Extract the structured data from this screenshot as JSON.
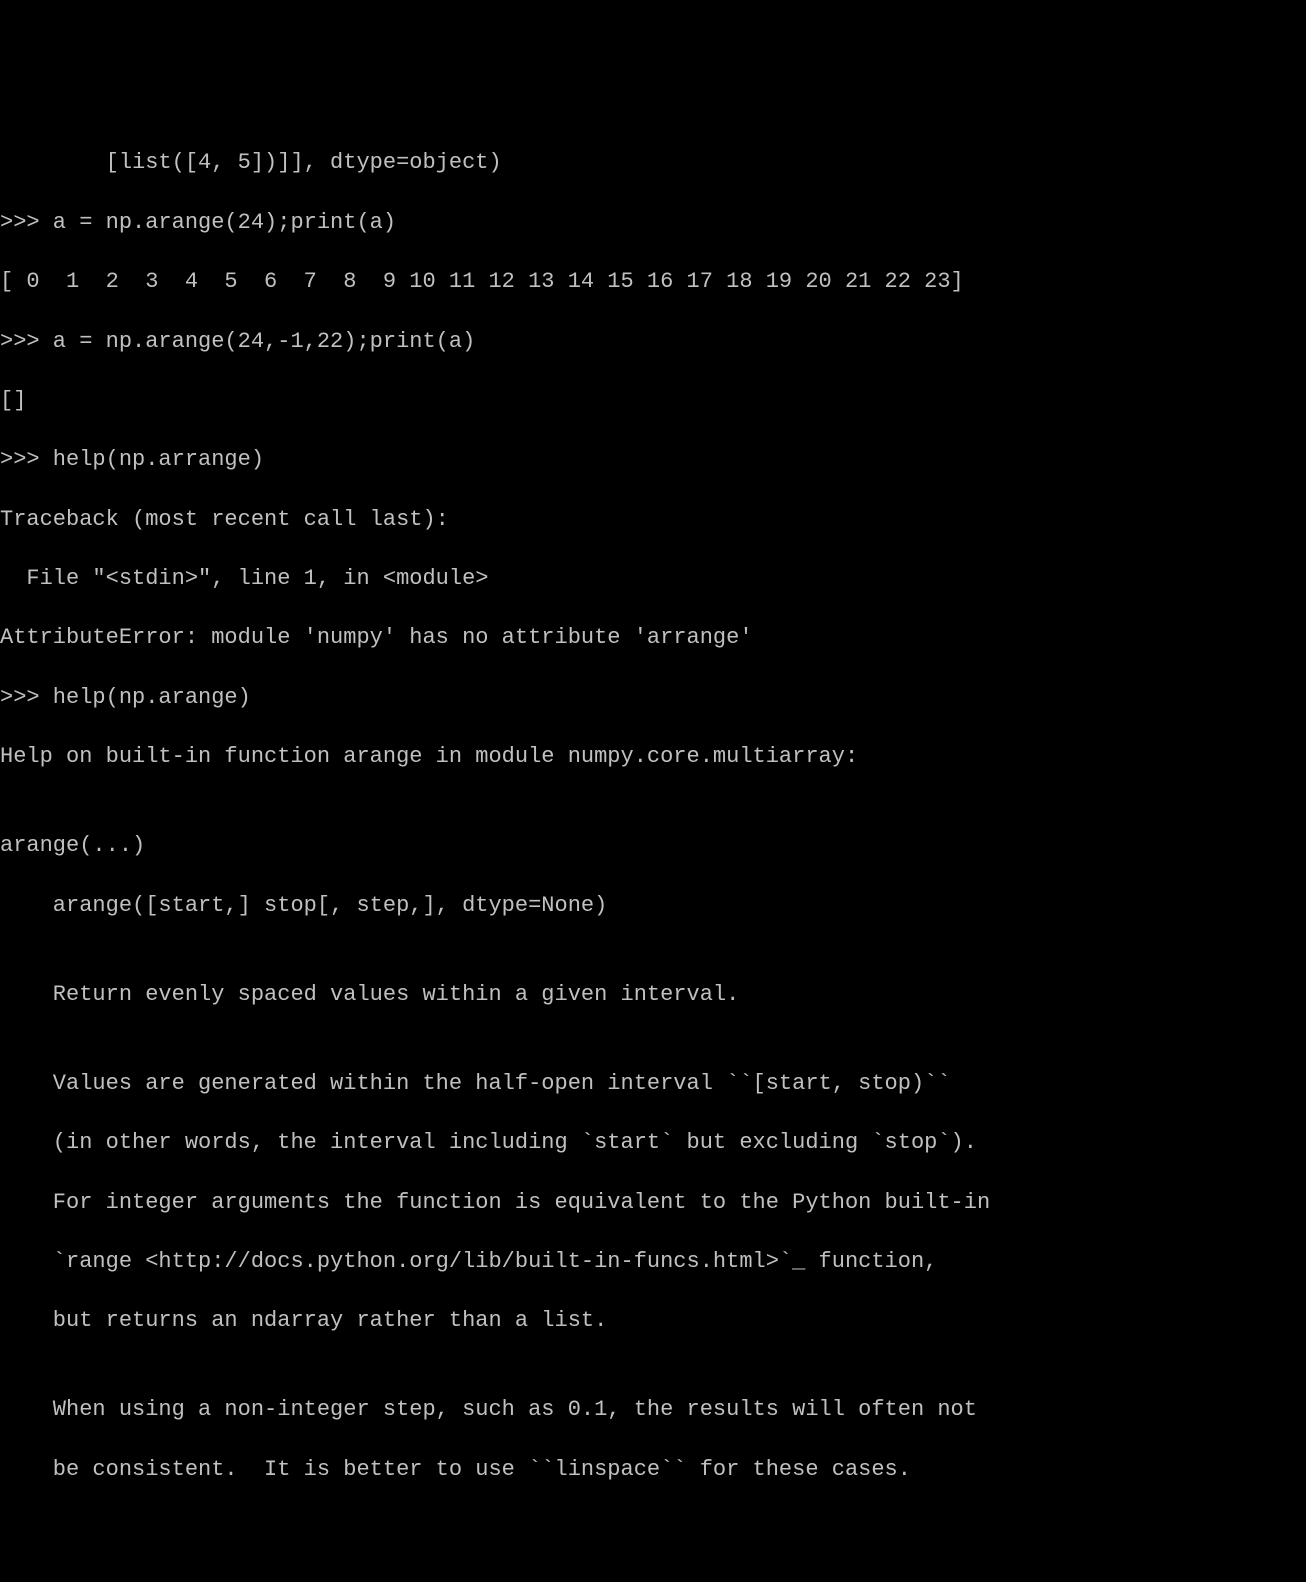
{
  "terminal": {
    "lines": [
      "        [list([4, 5])]], dtype=object)",
      ">>> a = np.arange(24);print(a)",
      "[ 0  1  2  3  4  5  6  7  8  9 10 11 12 13 14 15 16 17 18 19 20 21 22 23]",
      ">>> a = np.arange(24,-1,22);print(a)",
      "[]",
      ">>> help(np.arrange)",
      "Traceback (most recent call last):",
      "  File \"<stdin>\", line 1, in <module>",
      "AttributeError: module 'numpy' has no attribute 'arrange'",
      ">>> help(np.arange)",
      "Help on built-in function arange in module numpy.core.multiarray:",
      "",
      "arange(...)",
      "    arange([start,] stop[, step,], dtype=None)",
      "",
      "    Return evenly spaced values within a given interval.",
      "",
      "    Values are generated within the half-open interval ``[start, stop)``",
      "    (in other words, the interval including `start` but excluding `stop`).",
      "    For integer arguments the function is equivalent to the Python built-in",
      "    `range <http://docs.python.org/lib/built-in-funcs.html>`_ function,",
      "    but returns an ndarray rather than a list.",
      "",
      "    When using a non-integer step, such as 0.1, the results will often not",
      "    be consistent.  It is better to use ``linspace`` for these cases."
    ]
  }
}
